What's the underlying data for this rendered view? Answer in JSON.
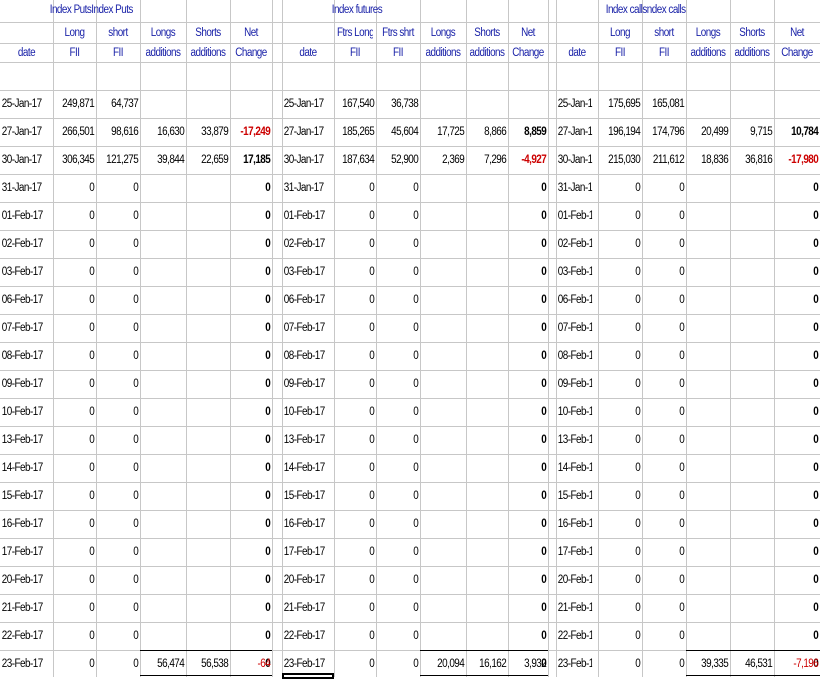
{
  "sections": [
    {
      "title": "Index PutsIndex Puts",
      "head_row1": [
        "",
        "Long",
        "short",
        "Longs",
        "Shorts",
        "Net"
      ],
      "head_row2": [
        "date",
        "FII",
        "FII",
        "additions",
        "additions",
        "Change"
      ],
      "data": [
        [
          "25-Jan-17",
          "249,871",
          "64,737",
          "",
          "",
          ""
        ],
        [
          "27-Jan-17",
          "266,501",
          "98,616",
          "16,630",
          "33,879",
          "-17,249"
        ],
        [
          "30-Jan-17",
          "306,345",
          "121,275",
          "39,844",
          "22,659",
          "17,185"
        ],
        [
          "31-Jan-17",
          "0",
          "0",
          "",
          "",
          "0"
        ],
        [
          "01-Feb-17",
          "0",
          "0",
          "",
          "",
          "0"
        ],
        [
          "02-Feb-17",
          "0",
          "0",
          "",
          "",
          "0"
        ],
        [
          "03-Feb-17",
          "0",
          "0",
          "",
          "",
          "0"
        ],
        [
          "06-Feb-17",
          "0",
          "0",
          "",
          "",
          "0"
        ],
        [
          "07-Feb-17",
          "0",
          "0",
          "",
          "",
          "0"
        ],
        [
          "08-Feb-17",
          "0",
          "0",
          "",
          "",
          "0"
        ],
        [
          "09-Feb-17",
          "0",
          "0",
          "",
          "",
          "0"
        ],
        [
          "10-Feb-17",
          "0",
          "0",
          "",
          "",
          "0"
        ],
        [
          "13-Feb-17",
          "0",
          "0",
          "",
          "",
          "0"
        ],
        [
          "14-Feb-17",
          "0",
          "0",
          "",
          "",
          "0"
        ],
        [
          "15-Feb-17",
          "0",
          "0",
          "",
          "",
          "0"
        ],
        [
          "16-Feb-17",
          "0",
          "0",
          "",
          "",
          "0"
        ],
        [
          "17-Feb-17",
          "0",
          "0",
          "",
          "",
          "0"
        ],
        [
          "20-Feb-17",
          "0",
          "0",
          "",
          "",
          "0"
        ],
        [
          "21-Feb-17",
          "0",
          "0",
          "",
          "",
          "0"
        ],
        [
          "22-Feb-17",
          "0",
          "0",
          "",
          "",
          "0"
        ],
        [
          "23-Feb-17",
          "0",
          "0",
          "",
          "",
          "0"
        ]
      ],
      "totals": [
        "",
        "",
        "",
        "56,474",
        "56,538",
        "-64"
      ]
    },
    {
      "title": "Index futures",
      "head_row1": [
        "",
        "Ftrs Long",
        "Ftrs shrt",
        "Longs",
        "Shorts",
        "Net"
      ],
      "head_row2": [
        "date",
        "FII",
        "FII",
        "additions",
        "additions",
        "Change"
      ],
      "data": [
        [
          "25-Jan-17",
          "167,540",
          "36,738",
          "",
          "",
          ""
        ],
        [
          "27-Jan-17",
          "185,265",
          "45,604",
          "17,725",
          "8,866",
          "8,859"
        ],
        [
          "30-Jan-17",
          "187,634",
          "52,900",
          "2,369",
          "7,296",
          "-4,927"
        ],
        [
          "31-Jan-17",
          "0",
          "0",
          "",
          "",
          "0"
        ],
        [
          "01-Feb-17",
          "0",
          "0",
          "",
          "",
          "0"
        ],
        [
          "02-Feb-17",
          "0",
          "0",
          "",
          "",
          "0"
        ],
        [
          "03-Feb-17",
          "0",
          "0",
          "",
          "",
          "0"
        ],
        [
          "06-Feb-17",
          "0",
          "0",
          "",
          "",
          "0"
        ],
        [
          "07-Feb-17",
          "0",
          "0",
          "",
          "",
          "0"
        ],
        [
          "08-Feb-17",
          "0",
          "0",
          "",
          "",
          "0"
        ],
        [
          "09-Feb-17",
          "0",
          "0",
          "",
          "",
          "0"
        ],
        [
          "10-Feb-17",
          "0",
          "0",
          "",
          "",
          "0"
        ],
        [
          "13-Feb-17",
          "0",
          "0",
          "",
          "",
          "0"
        ],
        [
          "14-Feb-17",
          "0",
          "0",
          "",
          "",
          "0"
        ],
        [
          "15-Feb-17",
          "0",
          "0",
          "",
          "",
          "0"
        ],
        [
          "16-Feb-17",
          "0",
          "0",
          "",
          "",
          "0"
        ],
        [
          "17-Feb-17",
          "0",
          "0",
          "",
          "",
          "0"
        ],
        [
          "20-Feb-17",
          "0",
          "0",
          "",
          "",
          "0"
        ],
        [
          "21-Feb-17",
          "0",
          "0",
          "",
          "",
          "0"
        ],
        [
          "22-Feb-17",
          "0",
          "0",
          "",
          "",
          "0"
        ],
        [
          "23-Feb-17",
          "0",
          "0",
          "",
          "",
          "0"
        ]
      ],
      "totals": [
        "",
        "",
        "",
        "20,094",
        "16,162",
        "3,932"
      ]
    },
    {
      "title": "Index callsndex calls",
      "head_row1": [
        "",
        "Long",
        "short",
        "Longs",
        "Shorts",
        "Net"
      ],
      "head_row2": [
        "date",
        "FII",
        "FII",
        "additions",
        "additions",
        "Change"
      ],
      "data": [
        [
          "25-Jan-17",
          "175,695",
          "165,081",
          "",
          "",
          ""
        ],
        [
          "27-Jan-17",
          "196,194",
          "174,796",
          "20,499",
          "9,715",
          "10,784"
        ],
        [
          "30-Jan-17",
          "215,030",
          "211,612",
          "18,836",
          "36,816",
          "-17,980"
        ],
        [
          "31-Jan-17",
          "0",
          "0",
          "",
          "",
          "0"
        ],
        [
          "01-Feb-17",
          "0",
          "0",
          "",
          "",
          "0"
        ],
        [
          "02-Feb-17",
          "0",
          "0",
          "",
          "",
          "0"
        ],
        [
          "03-Feb-17",
          "0",
          "0",
          "",
          "",
          "0"
        ],
        [
          "06-Feb-17",
          "0",
          "0",
          "",
          "",
          "0"
        ],
        [
          "07-Feb-17",
          "0",
          "0",
          "",
          "",
          "0"
        ],
        [
          "08-Feb-17",
          "0",
          "0",
          "",
          "",
          "0"
        ],
        [
          "09-Feb-17",
          "0",
          "0",
          "",
          "",
          "0"
        ],
        [
          "10-Feb-17",
          "0",
          "0",
          "",
          "",
          "0"
        ],
        [
          "13-Feb-17",
          "0",
          "0",
          "",
          "",
          "0"
        ],
        [
          "14-Feb-17",
          "0",
          "0",
          "",
          "",
          "0"
        ],
        [
          "15-Feb-17",
          "0",
          "0",
          "",
          "",
          "0"
        ],
        [
          "16-Feb-17",
          "0",
          "0",
          "",
          "",
          "0"
        ],
        [
          "17-Feb-17",
          "0",
          "0",
          "",
          "",
          "0"
        ],
        [
          "20-Feb-17",
          "0",
          "0",
          "",
          "",
          "0"
        ],
        [
          "21-Feb-17",
          "0",
          "0",
          "",
          "",
          "0"
        ],
        [
          "22-Feb-17",
          "0",
          "0",
          "",
          "",
          "0"
        ],
        [
          "23-Feb-17",
          "0",
          "0",
          "",
          "",
          "0"
        ]
      ],
      "totals": [
        "",
        "",
        "",
        "39,335",
        "46,531",
        "-7,196"
      ]
    }
  ],
  "colors": {
    "header_text": "#1a22a8",
    "negative_text": "#cc0000",
    "gridline": "#c7c7c7"
  }
}
